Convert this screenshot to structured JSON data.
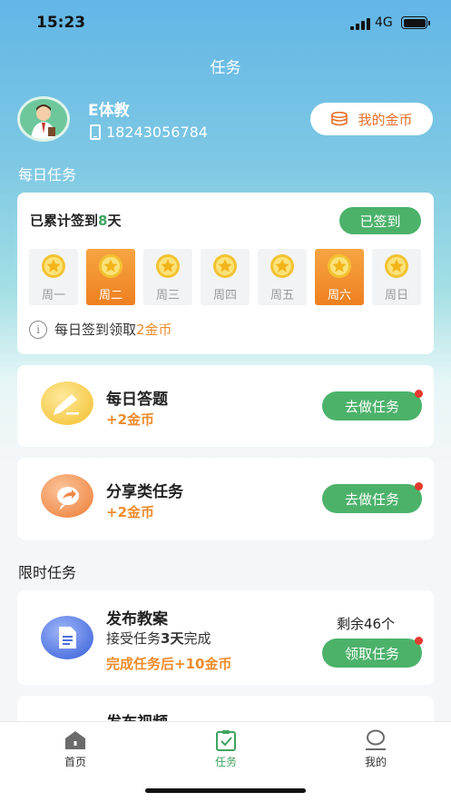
{
  "status_bar": {
    "time": "15:23",
    "network": "4G"
  },
  "header": {
    "title": "任务"
  },
  "user": {
    "name": "E体教",
    "phone": "18243056784",
    "coins_button": "我的金币"
  },
  "daily": {
    "section_title": "每日任务",
    "signin": {
      "prefix": "已累计签到",
      "count": "8",
      "suffix": "天",
      "button": "已签到",
      "days": [
        {
          "label": "周一",
          "active": false
        },
        {
          "label": "周二",
          "active": true
        },
        {
          "label": "周三",
          "active": false
        },
        {
          "label": "周四",
          "active": false
        },
        {
          "label": "周五",
          "active": false
        },
        {
          "label": "周六",
          "active": true
        },
        {
          "label": "周日",
          "active": false
        }
      ],
      "tip_prefix": "每日签到领取",
      "tip_reward": "2金币"
    },
    "tasks": [
      {
        "name": "每日答题",
        "reward": "+2金币",
        "button": "去做任务"
      },
      {
        "name": "分享类任务",
        "reward": "+2金币",
        "button": "去做任务"
      }
    ]
  },
  "limited": {
    "section_title": "限时任务",
    "tasks": [
      {
        "name": "发布教案",
        "desc_prefix": "接受任务",
        "desc_bold": "3天",
        "desc_suffix": "完成",
        "reward": "完成任务后+10金币",
        "remaining": "剩余46个",
        "button": "领取任务"
      },
      {
        "name": "发布视频"
      }
    ]
  },
  "tabbar": {
    "items": [
      {
        "label": "首页"
      },
      {
        "label": "任务"
      },
      {
        "label": "我的"
      }
    ]
  },
  "colors": {
    "primary_green": "#4cb26a",
    "accent_orange": "#ee8b2c"
  }
}
